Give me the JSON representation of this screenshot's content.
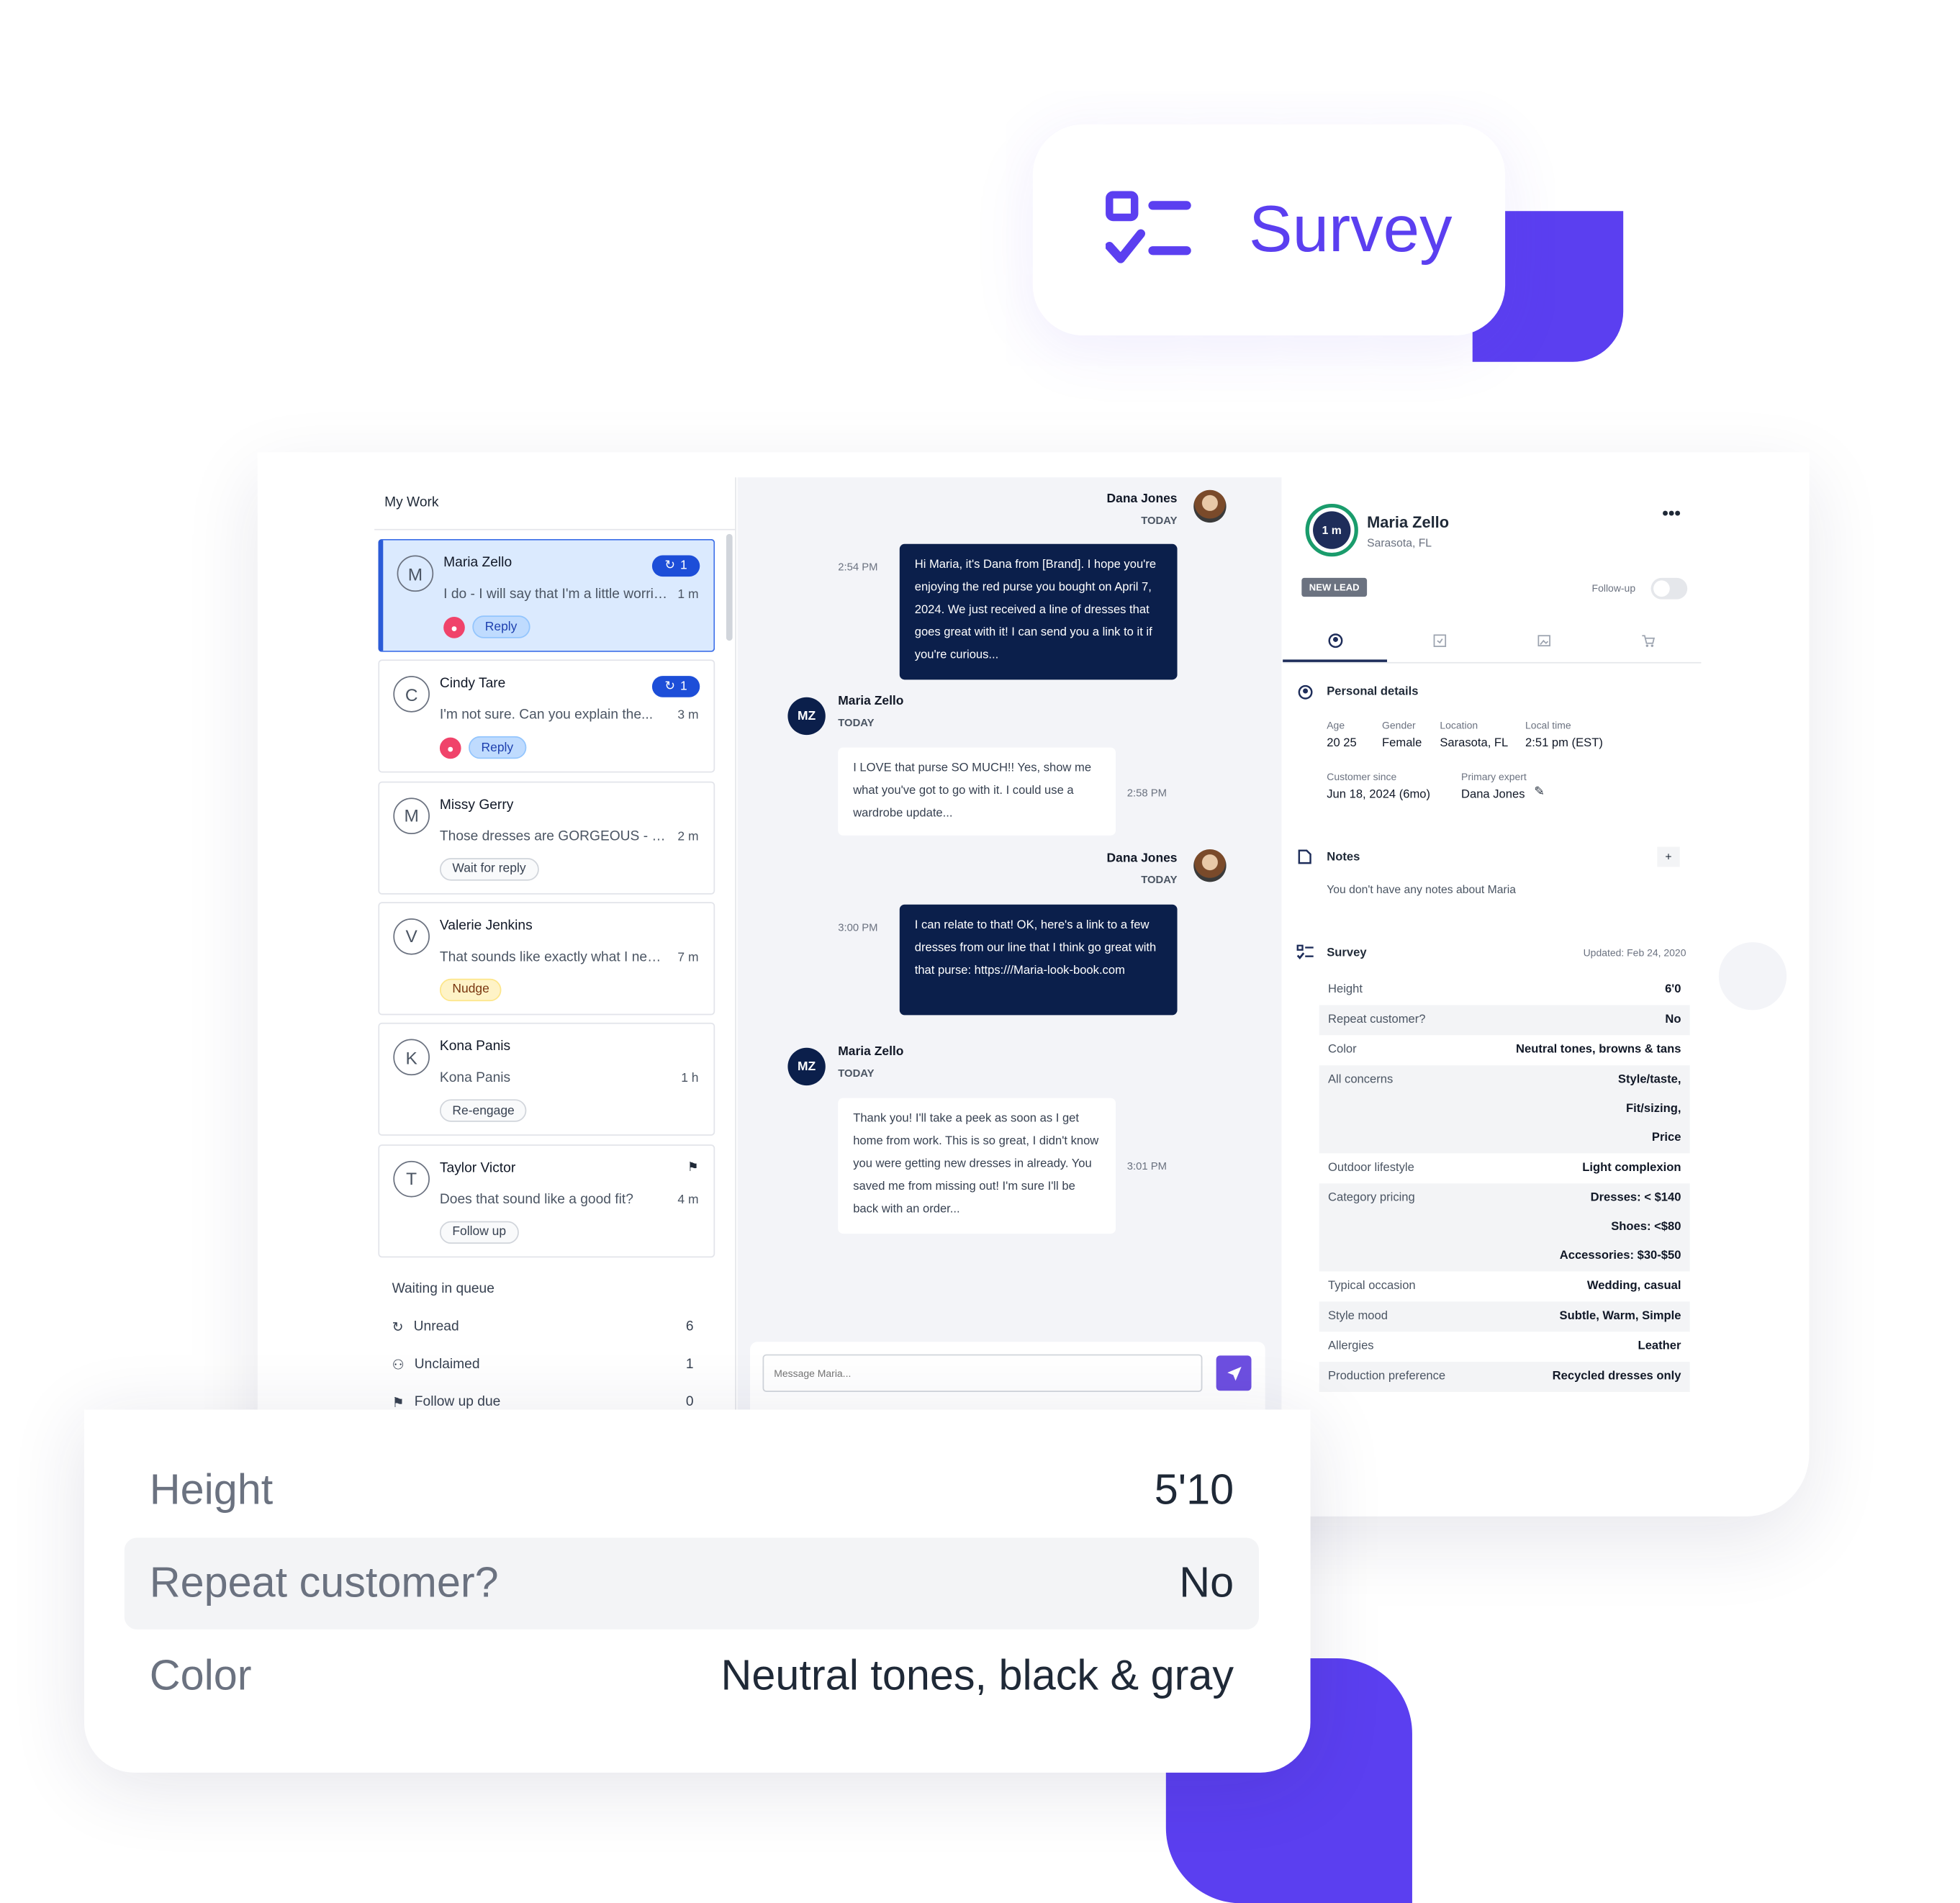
{
  "hero": {
    "title": "Survey",
    "icon": "survey-checklist-icon",
    "accent": "#5b3ff0"
  },
  "left": {
    "title": "My Work",
    "conversations": [
      {
        "initial": "M",
        "name": "Maria Zello",
        "preview": "I do - I will say that I'm a little worried...",
        "time": "1 m",
        "badge": "1",
        "chip": "Reply",
        "chip_style": "blue",
        "hot": true,
        "selected": true
      },
      {
        "initial": "C",
        "name": "Cindy Tare",
        "preview": "I'm not sure. Can you explain the...",
        "time": "3 m",
        "badge": "1",
        "chip": "Reply",
        "chip_style": "blue",
        "hot": true
      },
      {
        "initial": "M",
        "name": "Missy Gerry",
        "preview": "Those dresses are GORGEOUS - I...",
        "time": "2 m",
        "chip": "Wait for reply",
        "chip_style": "gray"
      },
      {
        "initial": "V",
        "name": "Valerie Jenkins",
        "preview": "That sounds like exactly what I need...",
        "time": "7 m",
        "chip": "Nudge",
        "chip_style": "yellow"
      },
      {
        "initial": "K",
        "name": "Kona Panis",
        "preview": "Kona Panis",
        "time": "1 h",
        "chip": "Re-engage",
        "chip_style": "gray"
      },
      {
        "initial": "T",
        "name": "Taylor Victor",
        "preview": "Does that sound like a good fit?",
        "time": "4 m",
        "chip": "Follow up",
        "chip_style": "gray",
        "flag": true
      }
    ],
    "queue": {
      "title": "Waiting in queue",
      "items": [
        {
          "label": "Unread",
          "count": "6",
          "icon": "chat-refresh-icon"
        },
        {
          "label": "Unclaimed",
          "count": "1",
          "icon": "user-add-icon"
        },
        {
          "label": "Follow up due",
          "count": "0",
          "icon": "flag-icon"
        }
      ]
    }
  },
  "chat": {
    "today": "TODAY",
    "messages": [
      {
        "from": "Dana Jones",
        "time": "2:54 PM",
        "text": "Hi Maria, it's Dana  from [Brand]. I hope you're enjoying the red purse you bought on April 7, 2024. We just received a line of dresses that goes great with it! I can send you a link to it if you're curious..."
      },
      {
        "from": "Maria Zello",
        "initials": "MZ",
        "time": "2:58 PM",
        "text": "I LOVE that purse SO MUCH!! Yes, show me what you've got to go with it. I could use a wardrobe update..."
      },
      {
        "from": "Dana Jones",
        "time": "3:00 PM",
        "text": "I can relate to that! OK, here's a link to a few dresses from our line that I think go great with that purse: https:///Maria-look-book.com"
      },
      {
        "from": "Maria Zello",
        "initials": "MZ",
        "time": "3:01 PM",
        "text": "Thank you! I'll take a peek as soon as I get home from work. This is so great, I didn't know you were getting new dresses in already. You saved me from missing out!  I'm sure I'll be back with an order..."
      }
    ],
    "input_placeholder": "Message Maria..."
  },
  "profile": {
    "timer": "1 m",
    "name": "Maria Zello",
    "location": "Sarasota, FL",
    "tag": "NEW LEAD",
    "followup_label": "Follow-up",
    "followup_on": false,
    "personal_title": "Personal details",
    "fields": [
      {
        "label": "Age",
        "value": "20 25"
      },
      {
        "label": "Gender",
        "value": "Female"
      },
      {
        "label": "Location",
        "value": "Sarasota, FL"
      },
      {
        "label": "Local time",
        "value": "2:51 pm (EST)"
      }
    ],
    "customer_since_label": "Customer since",
    "customer_since": "Jun 18, 2024 (6mo)",
    "expert_label": "Primary expert",
    "expert": "Dana Jones",
    "notes_title": "Notes",
    "notes_add": "+",
    "notes_empty": "You don't have any notes about Maria",
    "survey_title": "Survey",
    "survey_updated": "Updated: Feb 24, 2020",
    "survey": [
      {
        "k": "Height",
        "v": [
          "6'0"
        ]
      },
      {
        "k": "Repeat customer?",
        "v": [
          "No"
        ]
      },
      {
        "k": "Color",
        "v": [
          "Neutral tones, browns & tans"
        ]
      },
      {
        "k": "All concerns",
        "v": [
          "Style/taste,",
          "Fit/sizing,",
          "Price"
        ]
      },
      {
        "k": "Outdoor lifestyle",
        "v": [
          "Light complexion"
        ]
      },
      {
        "k": "Category pricing",
        "v": [
          "Dresses: < $140",
          "Shoes: <$80",
          "Accessories: $30-$50"
        ]
      },
      {
        "k": "Typical occasion",
        "v": [
          "Wedding, casual"
        ]
      },
      {
        "k": "Style mood",
        "v": [
          "Subtle, Warm, Simple"
        ]
      },
      {
        "k": "Allergies",
        "v": [
          "Leather"
        ]
      },
      {
        "k": "Production preference",
        "v": [
          "Recycled dresses only"
        ]
      }
    ]
  },
  "overlay": {
    "rows": [
      {
        "k": "Height",
        "v": "5'10"
      },
      {
        "k": "Repeat customer?",
        "v": "No"
      },
      {
        "k": "Color",
        "v": "Neutral tones, black & gray"
      }
    ]
  }
}
